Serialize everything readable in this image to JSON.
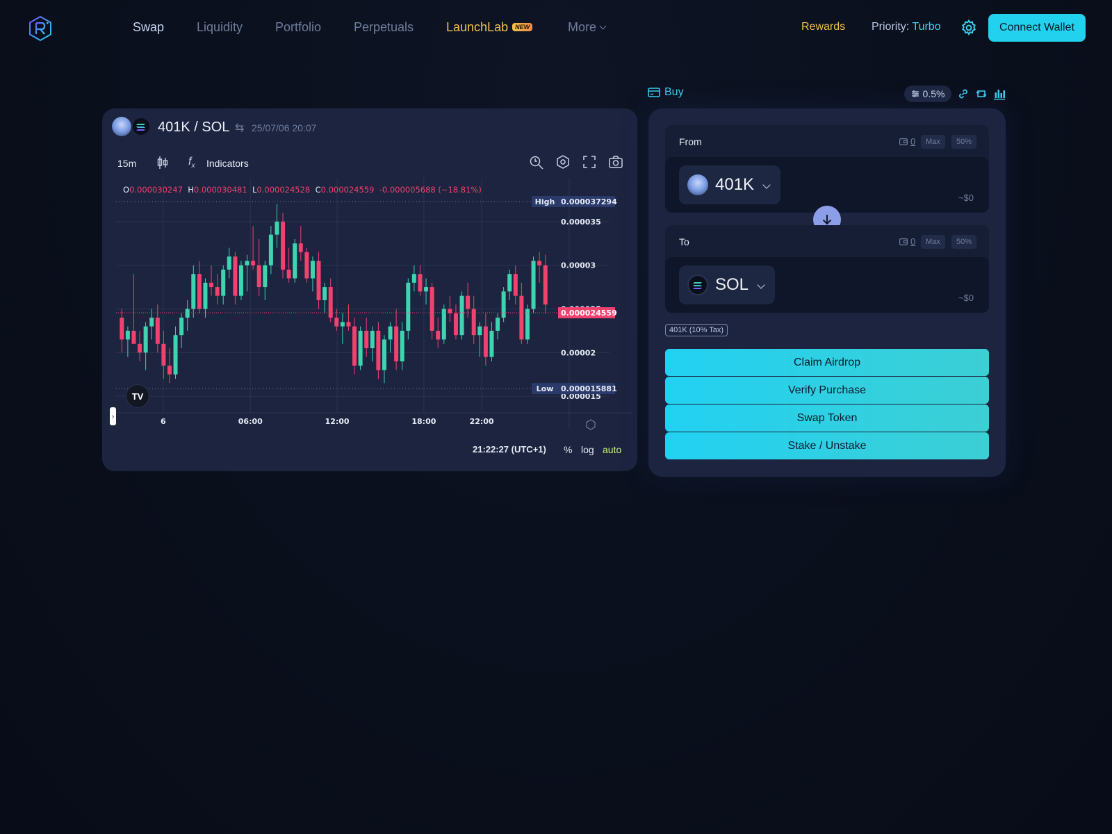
{
  "nav": {
    "items": [
      "Swap",
      "Liquidity",
      "Portfolio",
      "Perpetuals",
      "LaunchLab",
      "More"
    ],
    "launch_badge": "NEW",
    "rewards": "Rewards",
    "priority_label": "Priority:",
    "priority_value": "Turbo",
    "connect": "Connect Wallet"
  },
  "chart": {
    "pair": "401K / SOL",
    "datetime": "25/07/06 20:07",
    "timeframe": "15m",
    "indicators": "Indicators",
    "ohlc": {
      "o_label": "O",
      "o": "0.000030247",
      "h_label": "H",
      "h": "0.000030481",
      "l_label": "L",
      "l": "0.000024528",
      "c_label": "C",
      "c": "0.000024559",
      "change": "-0.000005688 (−18.81%)"
    },
    "clock": "21:22:27 (UTC+1)",
    "pct": "%",
    "log": "log",
    "auto": "auto",
    "tv": "TV"
  },
  "chart_data": {
    "type": "candlestick",
    "x_ticks": [
      "6",
      "06:00",
      "12:00",
      "18:00",
      "22:00"
    ],
    "y_ticks": [
      "0.000035",
      "0.00003",
      "0.000025",
      "0.00002",
      "0.000015"
    ],
    "y_tick_values": [
      3.5e-05,
      3e-05,
      2.5e-05,
      2e-05,
      1.5e-05
    ],
    "ylim": [
      1.35e-05,
      4e-05
    ],
    "high_label": "High",
    "high_value": "0.000037294",
    "low_label": "Low",
    "low_value": "0.000015881",
    "last_value": "0.000024559",
    "high": 3.7294e-05,
    "low": 1.5881e-05,
    "last": 2.4559e-05,
    "colors": {
      "up": "#3fd3b0",
      "down": "#f0416f",
      "grid": "#2a3350",
      "label_bg": "#2a3a6a"
    },
    "candles": [
      [
        2.4e-05,
        2.5e-05,
        2e-05,
        2.15e-05
      ],
      [
        2.15e-05,
        2.3e-05,
        1.95e-05,
        2.25e-05
      ],
      [
        2.25e-05,
        2.9e-05,
        2.15e-05,
        2.1e-05
      ],
      [
        2.1e-05,
        2.25e-05,
        1.9e-05,
        2e-05
      ],
      [
        2e-05,
        2.35e-05,
        1.8e-05,
        2.3e-05
      ],
      [
        2.3e-05,
        2.5e-05,
        2.15e-05,
        2.4e-05
      ],
      [
        2.4e-05,
        2.55e-05,
        2e-05,
        2.1e-05
      ],
      [
        2.1e-05,
        2.25e-05,
        1.7e-05,
        1.85e-05
      ],
      [
        1.85e-05,
        2.05e-05,
        1.65e-05,
        1.75e-05
      ],
      [
        1.75e-05,
        2.3e-05,
        1.7e-05,
        2.2e-05
      ],
      [
        2.2e-05,
        2.45e-05,
        2.05e-05,
        2.4e-05
      ],
      [
        2.4e-05,
        2.6e-05,
        2.25e-05,
        2.5e-05
      ],
      [
        2.5e-05,
        3e-05,
        2.4e-05,
        2.9e-05
      ],
      [
        2.9e-05,
        3.05e-05,
        2.45e-05,
        2.5e-05
      ],
      [
        2.5e-05,
        2.85e-05,
        2.4e-05,
        2.8e-05
      ],
      [
        2.8e-05,
        3e-05,
        2.65e-05,
        2.75e-05
      ],
      [
        2.75e-05,
        2.9e-05,
        2.55e-05,
        2.65e-05
      ],
      [
        2.65e-05,
        3e-05,
        2.55e-05,
        2.95e-05
      ],
      [
        2.95e-05,
        3.2e-05,
        2.85e-05,
        3.1e-05
      ],
      [
        3.1e-05,
        3.15e-05,
        2.55e-05,
        2.65e-05
      ],
      [
        2.65e-05,
        3.05e-05,
        2.6e-05,
        3e-05
      ],
      [
        3e-05,
        3.12e-05,
        2.7e-05,
        3.05e-05
      ],
      [
        3.05e-05,
        3.45e-05,
        2.95e-05,
        3e-05
      ],
      [
        3e-05,
        3.3e-05,
        2.65e-05,
        2.75e-05
      ],
      [
        2.75e-05,
        3.05e-05,
        2.6e-05,
        3e-05
      ],
      [
        3e-05,
        3.45e-05,
        2.9e-05,
        3.35e-05
      ],
      [
        3.35e-05,
        3.7e-05,
        3.2e-05,
        3.5e-05
      ],
      [
        3.5e-05,
        3.6e-05,
        2.85e-05,
        2.95e-05
      ],
      [
        2.95e-05,
        3.2e-05,
        2.8e-05,
        2.85e-05
      ],
      [
        2.85e-05,
        3.3e-05,
        2.8e-05,
        3.25e-05
      ],
      [
        3.25e-05,
        3.45e-05,
        3.05e-05,
        3.15e-05
      ],
      [
        3.15e-05,
        3.2e-05,
        2.8e-05,
        2.85e-05
      ],
      [
        2.85e-05,
        3.1e-05,
        2.7e-05,
        3.05e-05
      ],
      [
        3.05e-05,
        3.15e-05,
        2.5e-05,
        2.6e-05
      ],
      [
        2.6e-05,
        2.8e-05,
        2.45e-05,
        2.75e-05
      ],
      [
        2.75e-05,
        2.85e-05,
        2.35e-05,
        2.4e-05
      ],
      [
        2.4e-05,
        2.5e-05,
        2.25e-05,
        2.3e-05
      ],
      [
        2.3e-05,
        2.45e-05,
        2.1e-05,
        2.35e-05
      ],
      [
        2.35e-05,
        2.55e-05,
        2.25e-05,
        2.3e-05
      ],
      [
        2.3e-05,
        2.4e-05,
        1.75e-05,
        1.85e-05
      ],
      [
        1.85e-05,
        2.3e-05,
        1.8e-05,
        2.25e-05
      ],
      [
        2.25e-05,
        2.4e-05,
        1.95e-05,
        2.05e-05
      ],
      [
        2.05e-05,
        2.3e-05,
        1.9e-05,
        2.25e-05
      ],
      [
        2.25e-05,
        2.35e-05,
        1.7e-05,
        1.8e-05
      ],
      [
        1.8e-05,
        2.2e-05,
        1.65e-05,
        2.15e-05
      ],
      [
        2.15e-05,
        2.35e-05,
        2e-05,
        2.3e-05
      ],
      [
        2.3e-05,
        2.5e-05,
        1.8e-05,
        1.9e-05
      ],
      [
        1.9e-05,
        2.35e-05,
        1.8e-05,
        2.25e-05
      ],
      [
        2.25e-05,
        2.85e-05,
        2.15e-05,
        2.8e-05
      ],
      [
        2.8e-05,
        3e-05,
        2.7e-05,
        2.9e-05
      ],
      [
        2.9e-05,
        3e-05,
        2.65e-05,
        2.7e-05
      ],
      [
        2.7e-05,
        2.85e-05,
        2.55e-05,
        2.75e-05
      ],
      [
        2.75e-05,
        2.8e-05,
        2.15e-05,
        2.25e-05
      ],
      [
        2.25e-05,
        2.4e-05,
        2.05e-05,
        2.15e-05
      ],
      [
        2.15e-05,
        2.55e-05,
        2.1e-05,
        2.5e-05
      ],
      [
        2.5e-05,
        2.65e-05,
        2.35e-05,
        2.45e-05
      ],
      [
        2.45e-05,
        2.55e-05,
        2.15e-05,
        2.2e-05
      ],
      [
        2.2e-05,
        2.7e-05,
        2.15e-05,
        2.65e-05
      ],
      [
        2.65e-05,
        2.8e-05,
        2.4e-05,
        2.5e-05
      ],
      [
        2.5e-05,
        2.65e-05,
        2.1e-05,
        2.2e-05
      ],
      [
        2.2e-05,
        2.35e-05,
        1.95e-05,
        2.3e-05
      ],
      [
        2.3e-05,
        2.45e-05,
        1.85e-05,
        1.95e-05
      ],
      [
        1.95e-05,
        2.35e-05,
        1.9e-05,
        2.25e-05
      ],
      [
        2.25e-05,
        2.45e-05,
        2.15e-05,
        2.4e-05
      ],
      [
        2.4e-05,
        2.75e-05,
        2.35e-05,
        2.7e-05
      ],
      [
        2.7e-05,
        2.95e-05,
        2.6e-05,
        2.9e-05
      ],
      [
        2.9e-05,
        3e-05,
        2.55e-05,
        2.65e-05
      ],
      [
        2.65e-05,
        2.8e-05,
        2.1e-05,
        2.15e-05
      ],
      [
        2.15e-05,
        2.55e-05,
        2.1e-05,
        2.5e-05
      ],
      [
        2.5e-05,
        3.1e-05,
        2.45e-05,
        3.05e-05
      ],
      [
        3.05e-05,
        3.15e-05,
        2.8e-05,
        3e-05
      ],
      [
        3e-05,
        3.12e-05,
        2.45e-05,
        2.55e-05
      ]
    ]
  },
  "swap": {
    "buy": "Buy",
    "slippage": "0.5%",
    "from": {
      "label": "From",
      "balance": "0",
      "max": "Max",
      "half": "50%",
      "token": "401K",
      "usd": "~$0"
    },
    "to": {
      "label": "To",
      "balance": "0",
      "max": "Max",
      "half": "50%",
      "token": "SOL",
      "usd": "~$0"
    },
    "tax": "401K (10% Tax)",
    "actions": [
      "Claim Airdrop",
      "Verify Purchase",
      "Swap Token",
      "Stake / Unstake"
    ]
  }
}
